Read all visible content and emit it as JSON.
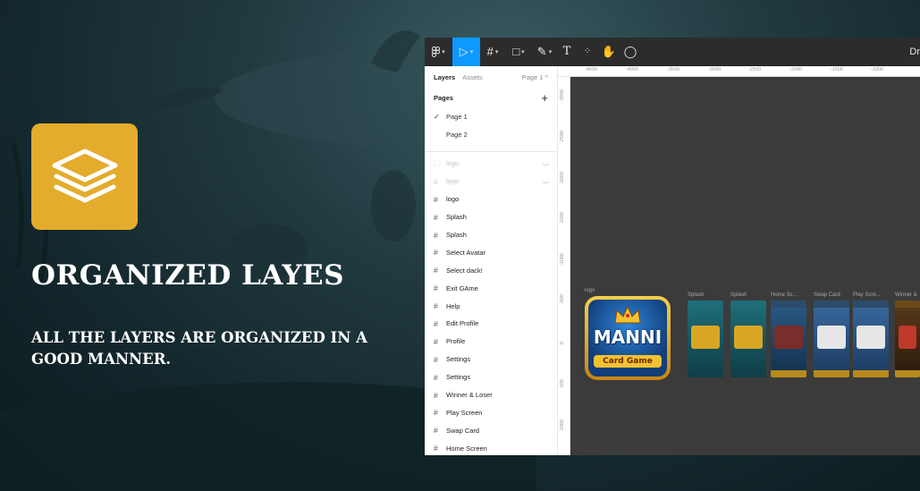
{
  "promo": {
    "title": "ORGANIZED LAYES",
    "description": "ALL THE LAYERS ARE ORGANIZED IN A GOOD MANNER.",
    "icon": "layers-stack-icon",
    "accent_color": "#e3ac2c"
  },
  "app": {
    "toolbar": {
      "tools": [
        "main-menu",
        "move",
        "frame",
        "shape",
        "pen",
        "text",
        "resources",
        "hand",
        "comment"
      ],
      "active_tool": "move",
      "right_label": "Dr"
    },
    "panel": {
      "tabs": [
        "Layers",
        "Assets"
      ],
      "page_selector": "Page 1 ^",
      "pages_header": "Pages",
      "pages": [
        {
          "label": "Page 1",
          "selected": true
        },
        {
          "label": "Page 2",
          "selected": false
        }
      ],
      "layers": [
        {
          "label": "logo",
          "hidden": true
        },
        {
          "label": "logo",
          "hidden": true
        },
        {
          "label": "logo",
          "hidden": false
        },
        {
          "label": "Splash",
          "hidden": false
        },
        {
          "label": "Splash",
          "hidden": false
        },
        {
          "label": "Select Avatar",
          "hidden": false
        },
        {
          "label": "Select dack!",
          "hidden": false
        },
        {
          "label": "Exit GAme",
          "hidden": false
        },
        {
          "label": "Help",
          "hidden": false
        },
        {
          "label": "Edit Profile",
          "hidden": false
        },
        {
          "label": "Profile",
          "hidden": false
        },
        {
          "label": "Settings",
          "hidden": false
        },
        {
          "label": "Settings",
          "hidden": false
        },
        {
          "label": "Winner & Loser",
          "hidden": false
        },
        {
          "label": "Play Screen",
          "hidden": false
        },
        {
          "label": "Swap Card",
          "hidden": false
        },
        {
          "label": "Home Screen",
          "hidden": false
        }
      ]
    },
    "ruler_top": [
      "-4500",
      "-4000",
      "-3500",
      "-3000",
      "-2500",
      "-2000",
      "-1500",
      "-1000"
    ],
    "ruler_left": [
      "-3000",
      "-2500",
      "-2000",
      "-1500",
      "-1000",
      "-500",
      "0",
      "500",
      "1000"
    ],
    "canvas": {
      "logo_label": "logo",
      "logo_title": "MANNI",
      "logo_subtitle": "Card Game",
      "frames": [
        "Splash",
        "Splash",
        "Home Sc...",
        "Swap Card",
        "Play Scre...",
        "Winner &"
      ]
    }
  }
}
